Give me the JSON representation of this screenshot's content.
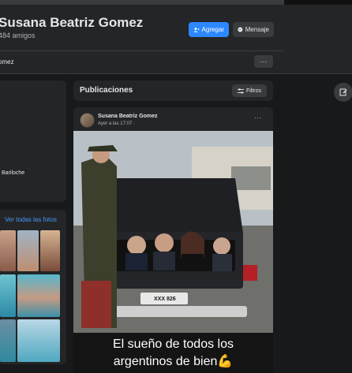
{
  "profile": {
    "name": "Susana Beatriz Gomez",
    "friends": "484 amigos",
    "add_label": "Agregar",
    "message_label": "Mensaje",
    "tab_name": "omez",
    "more": "···"
  },
  "intro": {
    "location": "Bariloche"
  },
  "photos": {
    "see_all": "Ver todas las fotos"
  },
  "posts_header": {
    "title": "Publicaciones",
    "filters": "Filtros"
  },
  "post": {
    "author": "Susana Beatriz Gomez",
    "time": "Ayer a las 17:07 ·",
    "more": "···",
    "caption_line1": "El sueño de todos los",
    "caption_line2": "argentinos de bien💪",
    "plate": "XXX 826"
  },
  "colors": {
    "accent": "#2d88ff",
    "bg": "#18191a",
    "card": "#242526"
  }
}
